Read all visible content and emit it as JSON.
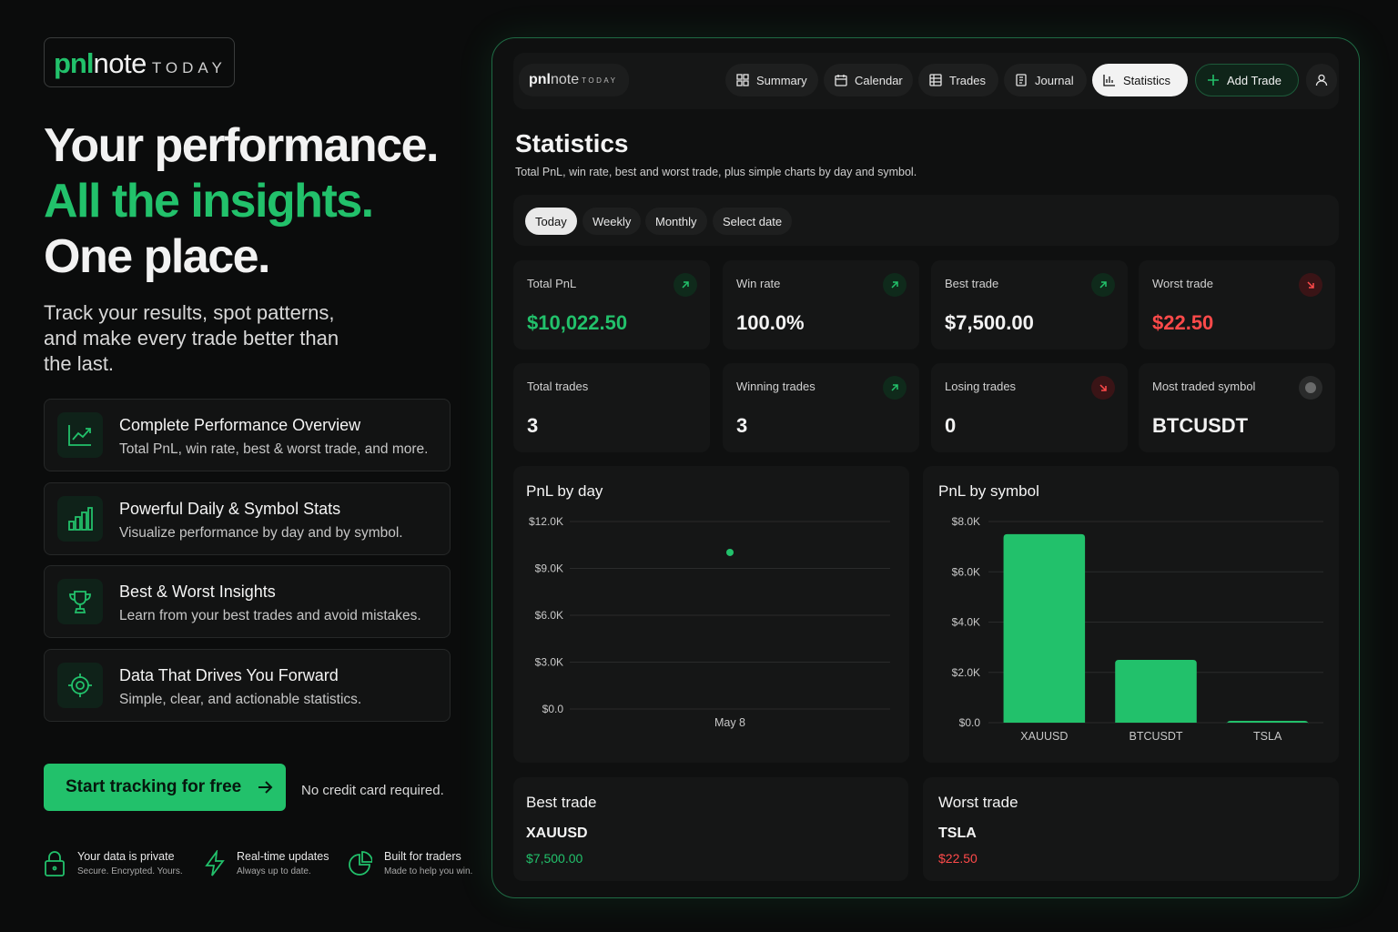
{
  "brand": {
    "pnl": "pnl",
    "note": "note",
    "today": "TODAY"
  },
  "hero": {
    "line1": "Your performance.",
    "line2": "All the insights.",
    "line3": "One place.",
    "tagline": "Track your results, spot patterns, and make every trade better than the last."
  },
  "features": [
    {
      "icon": "trend-chart-icon",
      "title": "Complete Performance Overview",
      "desc": "Total PnL, win rate, best & worst trade, and more."
    },
    {
      "icon": "bar-chart-icon",
      "title": "Powerful Daily & Symbol Stats",
      "desc": "Visualize performance by day and by symbol."
    },
    {
      "icon": "trophy-icon",
      "title": "Best & Worst Insights",
      "desc": "Learn from your best trades and avoid mistakes."
    },
    {
      "icon": "target-icon",
      "title": "Data That Drives You Forward",
      "desc": "Simple, clear, and actionable statistics."
    }
  ],
  "cta": {
    "label": "Start tracking for free",
    "note": "No credit card required."
  },
  "badges": [
    {
      "icon": "lock-icon",
      "title": "Your data is private",
      "sub": "Secure. Encrypted. Yours."
    },
    {
      "icon": "lightning-icon",
      "title": "Real-time updates",
      "sub": "Always up to date."
    },
    {
      "icon": "pie-icon",
      "title": "Built for traders",
      "sub": "Made to help you win."
    }
  ],
  "app": {
    "nav": {
      "summary": "Summary",
      "calendar": "Calendar",
      "trades": "Trades",
      "journal": "Journal",
      "statistics": "Statistics",
      "add_trade": "Add Trade",
      "active": "Statistics"
    },
    "title": "Statistics",
    "subtitle": "Total PnL, win rate, best and worst trade, plus simple charts by day and symbol.",
    "filters": [
      "Today",
      "Weekly",
      "Monthly",
      "Select date"
    ],
    "active_filter": "Today",
    "cards": [
      {
        "label": "Total PnL",
        "value": "$10,022.50",
        "tone": "green",
        "icon": "arrow-up-right-icon"
      },
      {
        "label": "Win rate",
        "value": "100.0%",
        "tone": "white",
        "icon": "arrow-up-right-icon"
      },
      {
        "label": "Best trade",
        "value": "$7,500.00",
        "tone": "white",
        "icon": "arrow-up-right-icon"
      },
      {
        "label": "Worst trade",
        "value": "$22.50",
        "tone": "red",
        "icon": "arrow-down-right-icon"
      },
      {
        "label": "Total trades",
        "value": "3",
        "tone": "white",
        "icon": ""
      },
      {
        "label": "Winning trades",
        "value": "3",
        "tone": "white",
        "icon": "arrow-up-right-icon"
      },
      {
        "label": "Losing trades",
        "value": "0",
        "tone": "white",
        "icon": "arrow-down-right-icon"
      },
      {
        "label": "Most traded symbol",
        "value": "BTCUSDT",
        "tone": "white",
        "icon": "dot-icon"
      }
    ],
    "best": {
      "title": "Best trade",
      "symbol": "XAUUSD",
      "value": "$7,500.00"
    },
    "worst": {
      "title": "Worst trade",
      "symbol": "TSLA",
      "value": "$22.50"
    }
  },
  "colors": {
    "accent": "#22c16b",
    "negative": "#ff4a4a",
    "background": "#0b0c0c",
    "card": "#151616"
  },
  "chart_data": [
    {
      "type": "scatter",
      "title": "PnL by day",
      "x": [
        "May 8"
      ],
      "y": [
        10022.5
      ],
      "yticks": [
        "$12.0K",
        "$9.0K",
        "$6.0K",
        "$3.0K",
        "$0.0"
      ],
      "ylim": [
        0,
        12000
      ],
      "grid": true
    },
    {
      "type": "bar",
      "title": "PnL by symbol",
      "categories": [
        "XAUUSD",
        "BTCUSDT",
        "TSLA"
      ],
      "values": [
        7500,
        2500,
        22.5
      ],
      "yticks": [
        "$8.0K",
        "$6.0K",
        "$4.0K",
        "$2.0K",
        "$0.0"
      ],
      "ylim": [
        0,
        8000
      ],
      "grid": true
    }
  ]
}
